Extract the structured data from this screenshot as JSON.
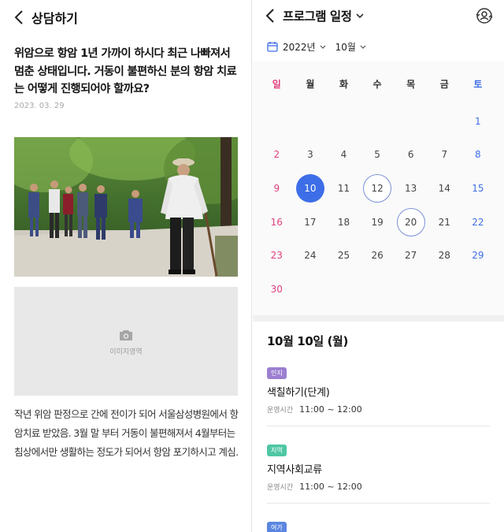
{
  "consult": {
    "header_title": "상담하기",
    "article_title": "위암으로 항암 1년 가까이 하시다 최근 나빠져서 멈춘 상태입니다. 거동이 불편하신 분의 항암 치료는 어떻게 진행되어야 할까요?",
    "date": "2023. 03. 29",
    "image_placeholder_label": "이미지영역",
    "body": "작년 위암 판정으로 간에 전이가 되어 서울삼성병원에서 항암치료 받았음. 3월 말 부터 거동이 불편해져서 4월부터는 침상에서만 생활하는 정도가 되어서 항암 포기하시고 계심."
  },
  "program": {
    "header_title": "프로그램 일정",
    "year": "2022년",
    "month": "10월",
    "weekdays": [
      "일",
      "월",
      "화",
      "수",
      "목",
      "금",
      "토"
    ],
    "calendar_days": [
      "",
      "",
      "",
      "",
      "",
      "",
      "1",
      "2",
      "3",
      "4",
      "5",
      "6",
      "7",
      "8",
      "9",
      "10",
      "11",
      "12",
      "13",
      "14",
      "15",
      "16",
      "17",
      "18",
      "19",
      "20",
      "21",
      "22",
      "23",
      "24",
      "25",
      "26",
      "27",
      "28",
      "29",
      "30",
      "",
      "",
      "",
      "",
      "",
      ""
    ],
    "selected_day": "10",
    "marked_days": [
      "12",
      "20"
    ],
    "selected_date_label": "10월 10일 (월)",
    "events": [
      {
        "tag": "인지",
        "tag_color": "#9b7fd1",
        "name": "색칠하기(단계)",
        "time_label": "운영시간",
        "time": "11:00 ~ 12:00"
      },
      {
        "tag": "지역",
        "tag_color": "#4fc7a4",
        "name": "지역사회교류",
        "time_label": "운영시간",
        "time": "11:00 ~ 12:00"
      },
      {
        "tag": "여가",
        "tag_color": "#5b86e0",
        "name": "",
        "time_label": "",
        "time": ""
      }
    ],
    "colors": {
      "accent": "#3d6ee8",
      "sunday": "#e0407f",
      "saturday": "#3f6ee6"
    }
  }
}
